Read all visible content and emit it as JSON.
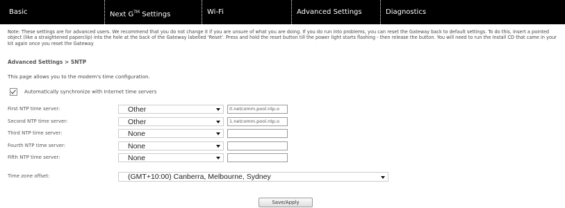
{
  "nav": {
    "tabs": [
      {
        "label": "Basic"
      },
      {
        "label": "Next G",
        "sup": "TM",
        "suffix": " Settings"
      },
      {
        "label": "Wi-Fi"
      },
      {
        "label": "Advanced Settings"
      },
      {
        "label": "Diagnostics"
      }
    ]
  },
  "note": "Note: These settings are for advanced users. We recommend that you do not change it if you are unsure of what you are doing. If you do run into problems, you can reset the Gateway back to default settings. To do this, insert a pointed object (like a straightened paperclip) into the hole at the back of the Gateway labelled 'Reset'. Press and hold the reset button till the power light starts flashing - then release the button. You will need to run the Install CD that came in your kit again once you reset the Gateway",
  "breadcrumb": "Advanced Settings > SNTP",
  "intro": "This page allows you to the modem's time configuration.",
  "auto_sync": {
    "label": "Automatically synchronize with Internet time servers",
    "checked": true
  },
  "ntp_servers": [
    {
      "label": "First NTP time server:",
      "selected": "Other",
      "value": "0.netcomm.pool.ntp.o"
    },
    {
      "label": "Second NTP time server:",
      "selected": "Other",
      "value": "1.netcomm.pool.ntp.o"
    },
    {
      "label": "Third NTP time server:",
      "selected": "None",
      "value": ""
    },
    {
      "label": "Fourth NTP time server:",
      "selected": "None",
      "value": ""
    },
    {
      "label": "Fifth NTP time server:",
      "selected": "None",
      "value": ""
    }
  ],
  "timezone": {
    "label": "Time zone offset:",
    "selected": "(GMT+10:00) Canberra, Melbourne, Sydney"
  },
  "save_button": "Save/Apply"
}
